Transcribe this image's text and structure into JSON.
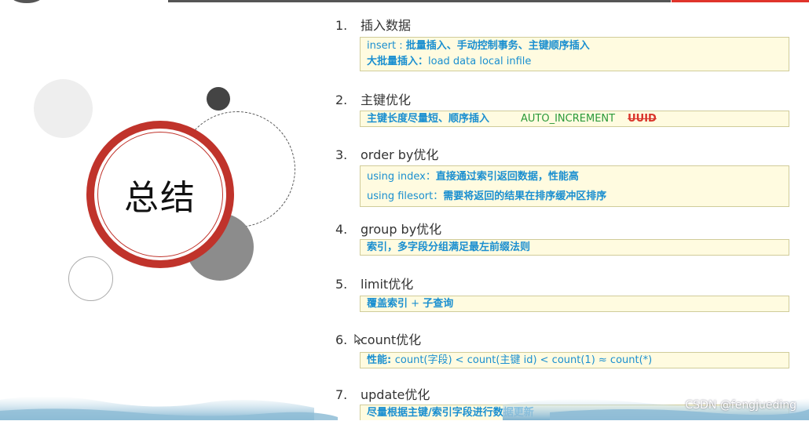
{
  "slide_title": "总结",
  "items": [
    {
      "num": "1.",
      "title": "插入数据",
      "lines": [
        {
          "a": "insert : ",
          "b": "批量插入、手动控制事务、主键顺序插入"
        },
        {
          "a": "",
          "b": "大批量插入：",
          "c": "load  data  local  infile"
        }
      ]
    },
    {
      "num": "2.",
      "title": "主键优化",
      "lines": [
        {
          "b": "主键长度尽量短、顺序插入",
          "green": "AUTO_INCREMENT",
          "strike": "UUID"
        }
      ]
    },
    {
      "num": "3.",
      "title": "order by优化",
      "lines": [
        {
          "a": "using index：",
          "b": "直接通过索引返回数据，性能高"
        },
        {
          "a": "using filesort：",
          "b": "需要将返回的结果在排序缓冲区排序"
        }
      ]
    },
    {
      "num": "4.",
      "title": "group by优化",
      "lines": [
        {
          "b": "索引，多字段分组满足最左前缀法则"
        }
      ]
    },
    {
      "num": "5.",
      "title": "limit优化",
      "lines": [
        {
          "b": "覆盖索引",
          "a": " + ",
          "c": "子查询"
        }
      ]
    },
    {
      "num": "6.",
      "title": "count优化",
      "lines": [
        {
          "b": "性能: ",
          "a": "count(字段) < count(主键 id) < count(1) ≈ count(*)"
        }
      ]
    },
    {
      "num": "7.",
      "title": "update优化",
      "lines": [
        {
          "b": "尽量根据主键/索引字段进行数据更新"
        }
      ]
    }
  ],
  "watermark": "CSDN @fengjueding",
  "colors": {
    "accent_red": "#c0332b",
    "text_blue": "#1a8fd0",
    "box_bg": "#fffbe0",
    "green": "#2a9a3a"
  }
}
